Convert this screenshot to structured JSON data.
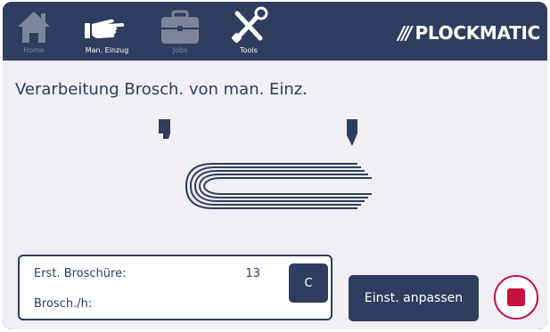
{
  "nav": {
    "items": [
      {
        "label": "Home",
        "icon": "home-icon",
        "active": false
      },
      {
        "label": "Man. Einzug",
        "icon": "hand-icon",
        "active": true
      },
      {
        "label": "Jobs",
        "icon": "briefcase-icon",
        "active": false
      },
      {
        "label": "Tools",
        "icon": "tools-icon",
        "active": true
      }
    ]
  },
  "brand": {
    "slashes": "///",
    "name": "PLOCKMATIC"
  },
  "main": {
    "title": "Verarbeitung Brosch. von man. Einz.",
    "counter": {
      "first_booklet_label": "Erst. Broschüre:",
      "first_booklet_value": "13",
      "rate_label": "Brosch./h:",
      "rate_value": "",
      "clear_label": "C"
    },
    "adjust_label": "Einst. anpassen",
    "stop_icon": "stop-icon"
  },
  "colors": {
    "header": "#2f3d5e",
    "background": "#f1eff3",
    "stop": "#c3103f",
    "inactive_icon": "#7d8598"
  }
}
